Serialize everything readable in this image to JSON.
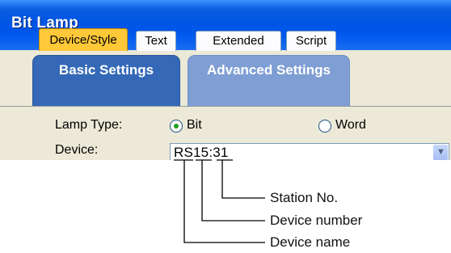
{
  "window": {
    "title": "Bit Lamp"
  },
  "tab_groups": [
    {
      "label": "Basic Settings",
      "tabs": [
        "Device/Style",
        "Text"
      ],
      "active_tab": "Device/Style"
    },
    {
      "label": "Advanced Settings",
      "tabs": [
        "Extended",
        "Script"
      ]
    }
  ],
  "form": {
    "lamp_type": {
      "label": "Lamp Type:",
      "options": [
        "Bit",
        "Word"
      ],
      "selected": "Bit"
    },
    "device": {
      "label": "Device:",
      "value": "RS15:31"
    }
  },
  "device_value_parts": {
    "name": "RS",
    "number": "15",
    "station": "31"
  },
  "callouts": [
    {
      "label": "Station No."
    },
    {
      "label": "Device number"
    },
    {
      "label": "Device name"
    }
  ]
}
